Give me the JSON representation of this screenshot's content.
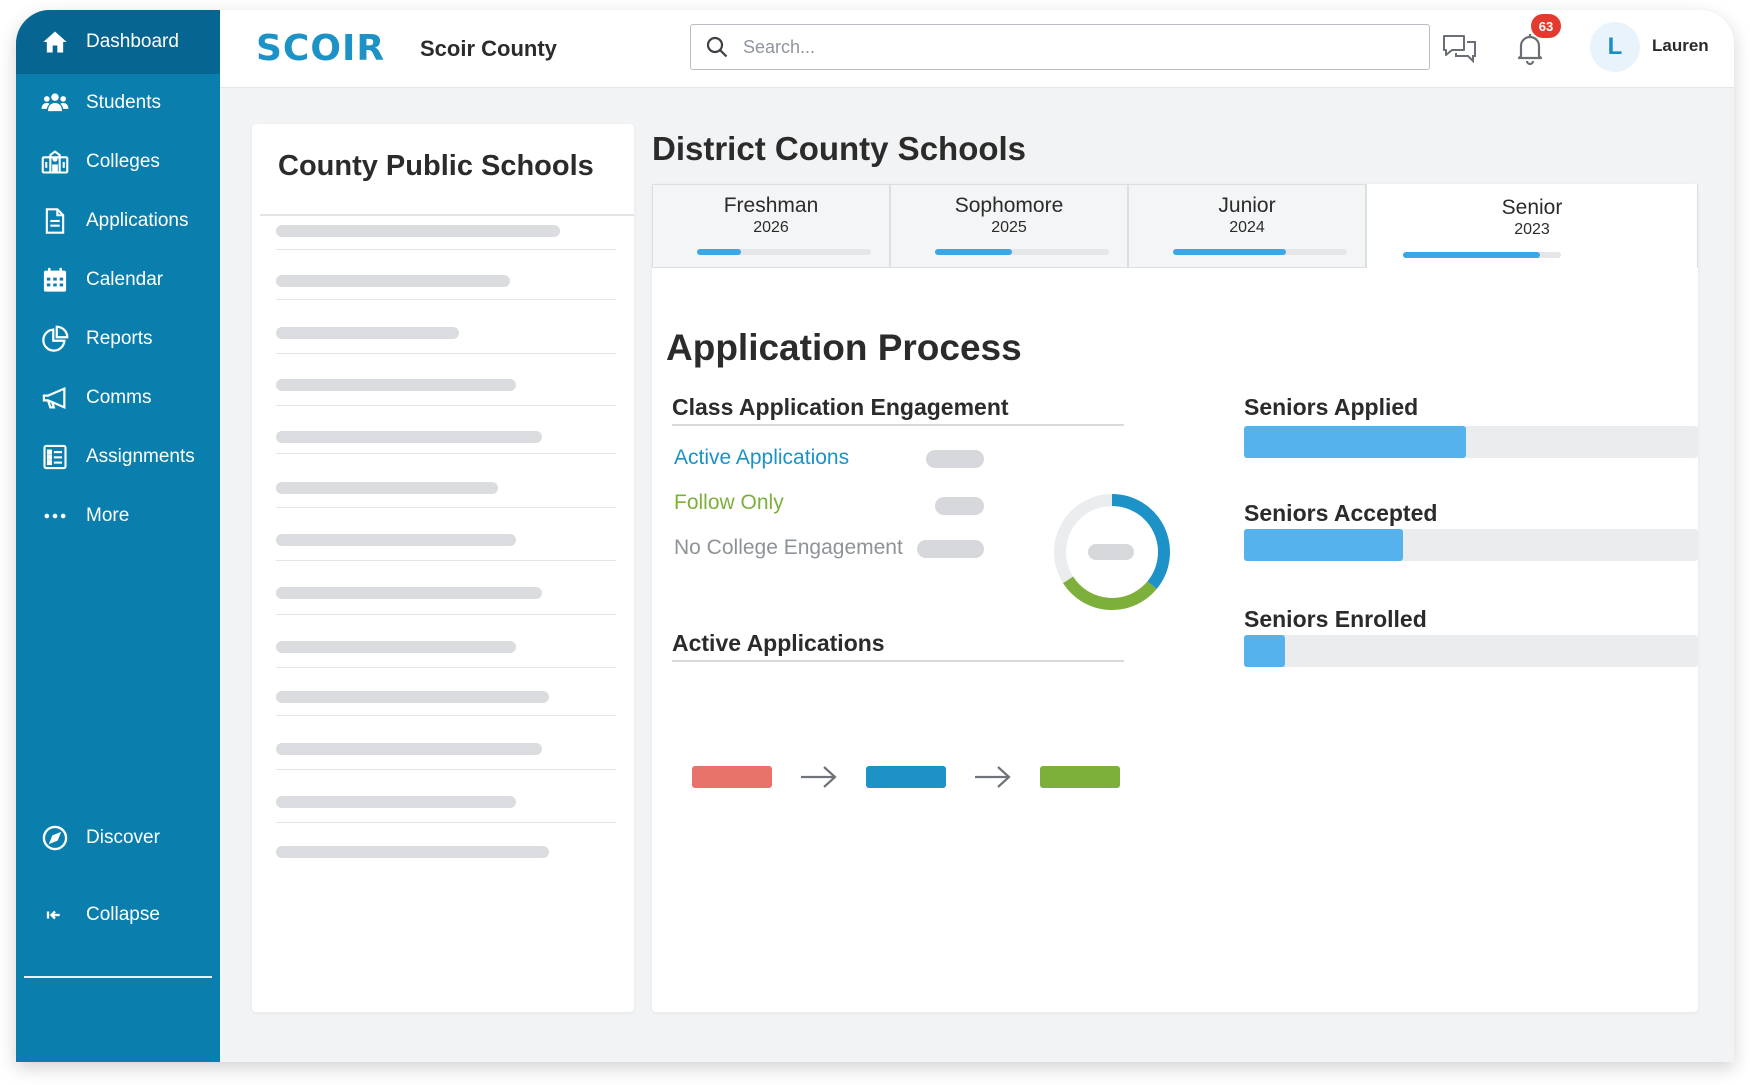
{
  "sidebar": {
    "items": [
      {
        "label": "Dashboard",
        "icon": "home-icon",
        "active": true
      },
      {
        "label": "Students",
        "icon": "users-icon"
      },
      {
        "label": "Colleges",
        "icon": "college-building-icon"
      },
      {
        "label": "Applications",
        "icon": "document-icon"
      },
      {
        "label": "Calendar",
        "icon": "calendar-icon"
      },
      {
        "label": "Reports",
        "icon": "pie-chart-icon"
      },
      {
        "label": "Comms",
        "icon": "megaphone-icon"
      },
      {
        "label": "Assignments",
        "icon": "checklist-icon"
      },
      {
        "label": "More",
        "icon": "more-dots-icon"
      }
    ],
    "discover_label": "Discover",
    "collapse_label": "Collapse"
  },
  "header": {
    "logo_text": "SCOIR",
    "county_name": "Scoir County",
    "search_placeholder": "Search...",
    "notifications_count": "63",
    "user_initial": "L",
    "user_name": "Lauren"
  },
  "left_panel": {
    "title": "County Public Schools"
  },
  "district": {
    "title": "District County Schools",
    "tabs": [
      {
        "name": "Freshman",
        "year": "2026",
        "progress": 0.25,
        "active": false
      },
      {
        "name": "Sophomore",
        "year": "2025",
        "progress": 0.44,
        "active": false
      },
      {
        "name": "Junior",
        "year": "2024",
        "progress": 0.65,
        "active": false
      },
      {
        "name": "Senior",
        "year": "2023",
        "progress": 0.87,
        "active": true
      }
    ]
  },
  "application_process": {
    "title": "Application Process",
    "engagement_title": "Class Application Engagement",
    "engagement_items": [
      {
        "label": "Active Applications",
        "color": "#1c92c7"
      },
      {
        "label": "Follow Only",
        "color": "#7db03b"
      },
      {
        "label": "No College Engagement",
        "color": "#8e9399"
      }
    ],
    "donut": {
      "active": 0.36,
      "follow": 0.3,
      "none": 0.34
    },
    "flow_title": "Active Applications",
    "flow_colors": [
      "#e8736a",
      "#1c92c7",
      "#7db03b"
    ],
    "stats": [
      {
        "label": "Seniors Applied",
        "fraction": 0.49
      },
      {
        "label": "Seniors Accepted",
        "fraction": 0.35
      },
      {
        "label": "Seniors Enrolled",
        "fraction": 0.09
      }
    ]
  },
  "colors": {
    "sidebar": "#0a7fae",
    "sidebar_active": "#076592",
    "accent": "#1c92c7",
    "progress": "#3ba7e6",
    "badge": "#e23a2e"
  }
}
